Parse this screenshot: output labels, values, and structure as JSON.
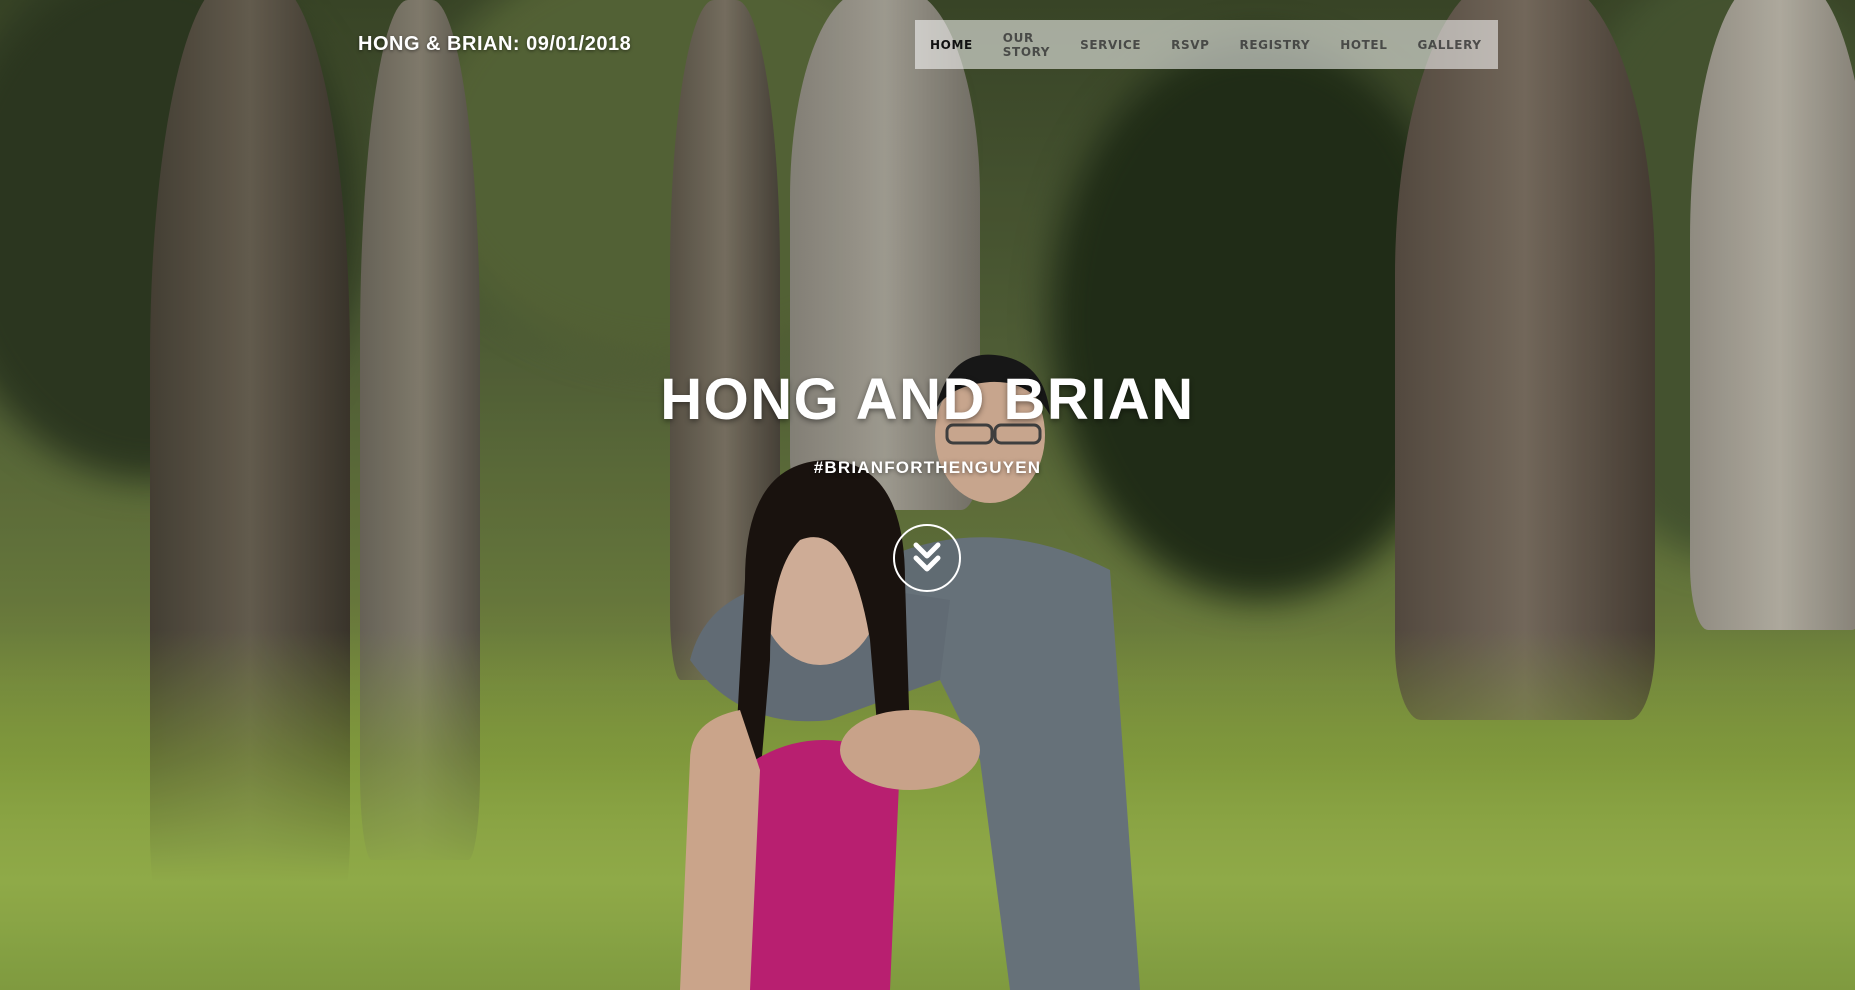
{
  "site": {
    "brand": "HONG & BRIAN: 09/01/2018"
  },
  "nav": {
    "items": [
      {
        "label": "HOME",
        "active": true
      },
      {
        "label": "OUR STORY",
        "active": false
      },
      {
        "label": "SERVICE",
        "active": false
      },
      {
        "label": "RSVP",
        "active": false
      },
      {
        "label": "REGISTRY",
        "active": false
      },
      {
        "label": "HOTEL",
        "active": false
      },
      {
        "label": "GALLERY",
        "active": false
      }
    ]
  },
  "hero": {
    "title": "HONG AND BRIAN",
    "subtitle": "#BRIANFORTHENGUYEN",
    "scroll_icon": "chevron-double-down-icon",
    "background": "forest-couple-photo"
  },
  "colors": {
    "nav_background": "#ffffffb3",
    "text_primary": "#ffffff",
    "nav_text": "#333333",
    "foliage_dark": "#3d4a2a",
    "grass": "#9cb94f"
  }
}
